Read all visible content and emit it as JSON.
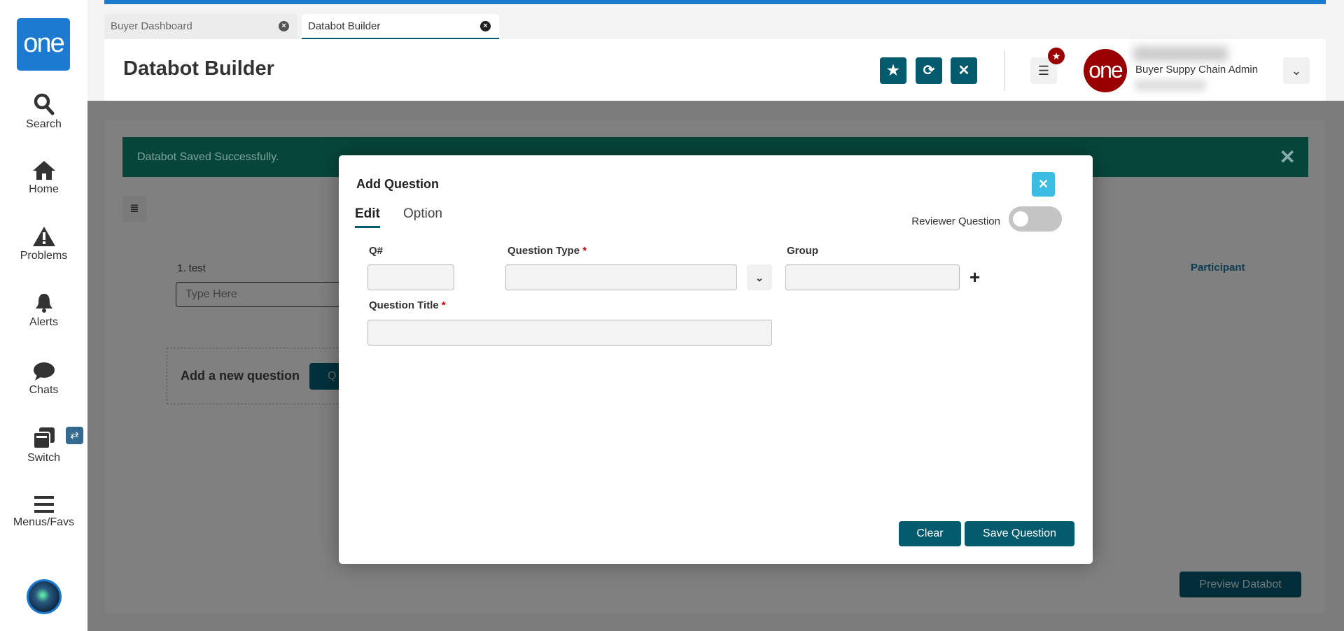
{
  "sidebar": {
    "logo": "one",
    "items": [
      {
        "label": "Search",
        "icon": "search-icon"
      },
      {
        "label": "Home",
        "icon": "home-icon"
      },
      {
        "label": "Problems",
        "icon": "warning-icon"
      },
      {
        "label": "Alerts",
        "icon": "bell-icon"
      },
      {
        "label": "Chats",
        "icon": "chat-icon"
      },
      {
        "label": "Switch",
        "icon": "switch-icon"
      },
      {
        "label": "Menus/Favs",
        "icon": "menu-icon"
      }
    ],
    "switch_badge": "⇄"
  },
  "tabs": [
    {
      "label": "Buyer Dashboard",
      "active": false
    },
    {
      "label": "Databot Builder",
      "active": true
    }
  ],
  "header": {
    "title": "Databot Builder",
    "user_role": "Buyer Suppy Chain Admin",
    "avatar_text": "one"
  },
  "page": {
    "banner": "Databot Saved Successfully.",
    "question_label": "1. test",
    "answer_placeholder": "Type Here",
    "participant": "Participant",
    "add_new_question": "Add a new question",
    "add_button_partial": "Q",
    "preview_button": "Preview Databot"
  },
  "modal": {
    "title": "Add Question",
    "tabs": [
      "Edit",
      "Option"
    ],
    "reviewer_label": "Reviewer Question",
    "reviewer_on": false,
    "qnum_label": "Q#",
    "qtype_label": "Question Type",
    "group_label": "Group",
    "qtitle_label": "Question Title",
    "required_mark": "*",
    "plus": "+",
    "clear": "Clear",
    "save": "Save Question"
  },
  "colors": {
    "primary": "#045b6d",
    "brand_blue": "#1c7bd0",
    "close_cyan": "#3bbde3",
    "success": "#06463a"
  }
}
